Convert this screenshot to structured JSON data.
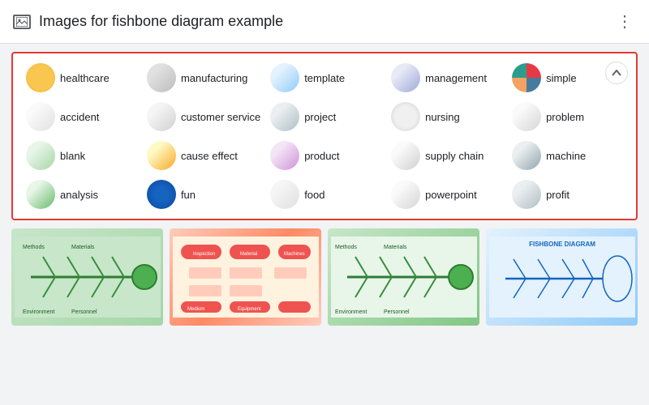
{
  "header": {
    "title": "Images for fishbone diagram example",
    "menu_icon": "⋮",
    "chevron": "∧"
  },
  "tags": [
    {
      "id": "healthcare",
      "label": "healthcare",
      "thumb_class": "thumb-healthcare"
    },
    {
      "id": "manufacturing",
      "label": "manufacturing",
      "thumb_class": "thumb-manufacturing"
    },
    {
      "id": "template",
      "label": "template",
      "thumb_class": "thumb-template"
    },
    {
      "id": "management",
      "label": "management",
      "thumb_class": "thumb-management"
    },
    {
      "id": "simple",
      "label": "simple",
      "thumb_class": "thumb-simple"
    },
    {
      "id": "accident",
      "label": "accident",
      "thumb_class": "thumb-accident"
    },
    {
      "id": "customer-service",
      "label": "customer service",
      "thumb_class": "thumb-customer"
    },
    {
      "id": "project",
      "label": "project",
      "thumb_class": "thumb-project"
    },
    {
      "id": "nursing",
      "label": "nursing",
      "thumb_class": "thumb-nursing"
    },
    {
      "id": "problem",
      "label": "problem",
      "thumb_class": "thumb-problem"
    },
    {
      "id": "blank",
      "label": "blank",
      "thumb_class": "thumb-blank"
    },
    {
      "id": "cause-effect",
      "label": "cause effect",
      "thumb_class": "thumb-cause"
    },
    {
      "id": "product",
      "label": "product",
      "thumb_class": "thumb-product"
    },
    {
      "id": "supply-chain",
      "label": "supply chain",
      "thumb_class": "thumb-supply"
    },
    {
      "id": "machine",
      "label": "machine",
      "thumb_class": "thumb-machine"
    },
    {
      "id": "analysis",
      "label": "analysis",
      "thumb_class": "thumb-analysis"
    },
    {
      "id": "fun",
      "label": "fun",
      "thumb_class": "thumb-fun"
    },
    {
      "id": "food",
      "label": "food",
      "thumb_class": "thumb-food"
    },
    {
      "id": "powerpoint",
      "label": "powerpoint",
      "thumb_class": "thumb-powerpoint"
    },
    {
      "id": "profit",
      "label": "profit",
      "thumb_class": "thumb-profit"
    }
  ],
  "bottom_images": [
    {
      "id": "img1",
      "class": "img-fishbone-1"
    },
    {
      "id": "img2",
      "class": "img-fishbone-2"
    },
    {
      "id": "img3",
      "class": "img-fishbone-3"
    },
    {
      "id": "img4",
      "class": "img-fishbone-4"
    }
  ]
}
